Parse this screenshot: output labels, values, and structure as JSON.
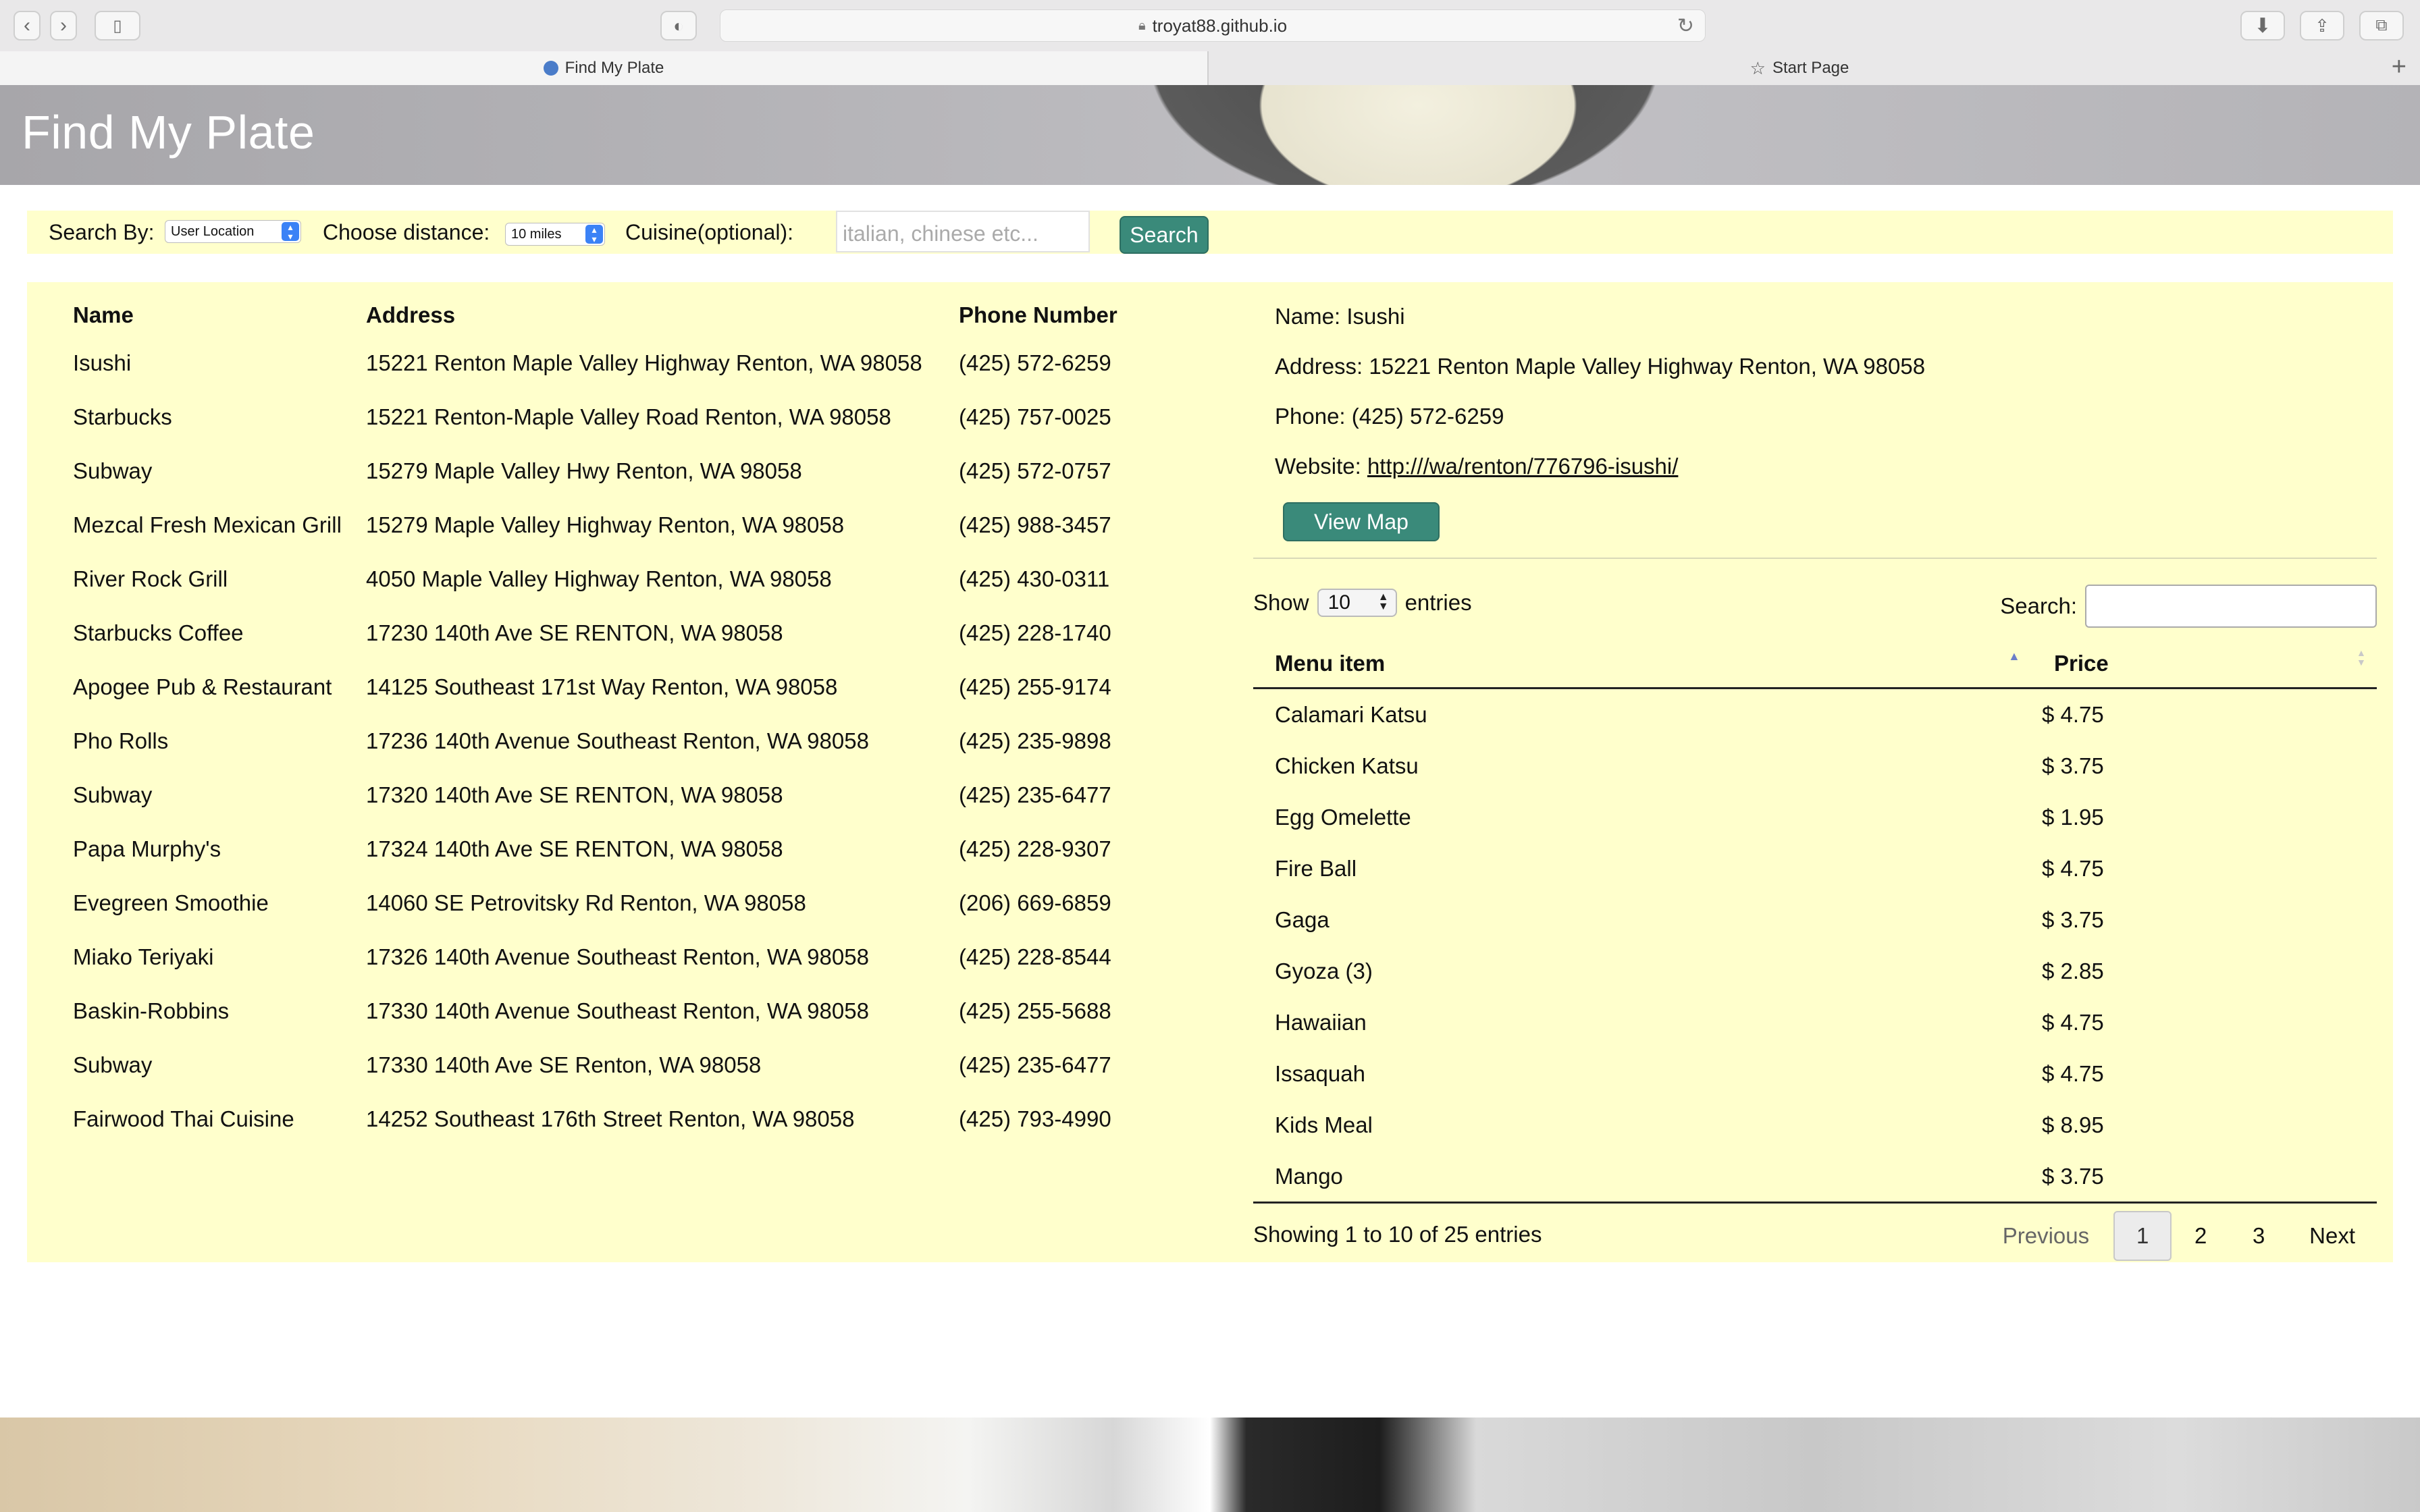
{
  "browser": {
    "url": "troyat88.github.io",
    "tabs": [
      {
        "label": "Find My Plate"
      },
      {
        "label": "Start Page"
      }
    ]
  },
  "header": {
    "title": "Find My Plate"
  },
  "search_bar": {
    "search_by_label": "Search By:",
    "search_by_value": "User Location",
    "distance_label": "Choose distance:",
    "distance_value": "10 miles",
    "cuisine_label": "Cuisine(optional):",
    "cuisine_placeholder": "italian, chinese etc...",
    "search_button": "Search"
  },
  "restaurants": {
    "columns": [
      "Name",
      "Address",
      "Phone Number"
    ],
    "rows": [
      {
        "name": "Isushi",
        "address": "15221 Renton Maple Valley Highway Renton, WA 98058",
        "phone": "(425) 572-6259"
      },
      {
        "name": "Starbucks",
        "address": "15221 Renton-Maple Valley Road Renton, WA 98058",
        "phone": "(425) 757-0025"
      },
      {
        "name": "Subway",
        "address": "15279 Maple Valley Hwy Renton, WA 98058",
        "phone": "(425) 572-0757"
      },
      {
        "name": "Mezcal Fresh Mexican Grill",
        "address": "15279 Maple Valley Highway Renton, WA 98058",
        "phone": "(425) 988-3457"
      },
      {
        "name": "River Rock Grill",
        "address": "4050 Maple Valley Highway Renton, WA 98058",
        "phone": "(425) 430-0311"
      },
      {
        "name": "Starbucks Coffee",
        "address": "17230 140th Ave SE RENTON, WA 98058",
        "phone": "(425) 228-1740"
      },
      {
        "name": "Apogee Pub & Restaurant",
        "address": "14125 Southeast 171st Way Renton, WA 98058",
        "phone": "(425) 255-9174"
      },
      {
        "name": "Pho Rolls",
        "address": "17236 140th Avenue Southeast Renton, WA 98058",
        "phone": "(425) 235-9898"
      },
      {
        "name": "Subway",
        "address": "17320 140th Ave SE RENTON, WA 98058",
        "phone": "(425) 235-6477"
      },
      {
        "name": "Papa Murphy's",
        "address": "17324 140th Ave SE RENTON, WA 98058",
        "phone": "(425) 228-9307"
      },
      {
        "name": "Evegreen Smoothie",
        "address": "14060 SE Petrovitsky Rd Renton, WA 98058",
        "phone": "(206) 669-6859"
      },
      {
        "name": "Miako Teriyaki",
        "address": "17326 140th Avenue Southeast Renton, WA 98058",
        "phone": "(425) 228-8544"
      },
      {
        "name": "Baskin-Robbins",
        "address": "17330 140th Avenue Southeast Renton, WA 98058",
        "phone": "(425) 255-5688"
      },
      {
        "name": "Subway",
        "address": "17330 140th Ave SE Renton, WA 98058",
        "phone": "(425) 235-6477"
      },
      {
        "name": "Fairwood Thai Cuisine",
        "address": "14252 Southeast 176th Street Renton, WA 98058",
        "phone": "(425) 793-4990"
      }
    ]
  },
  "detail": {
    "name": "Name: Isushi",
    "address": "Address: 15221 Renton Maple Valley Highway Renton, WA 98058",
    "phone": "Phone: (425) 572-6259",
    "website_label": "Website:",
    "website_url": "http:///wa/renton/776796-isushi/",
    "view_map_button": "View Map"
  },
  "menu": {
    "show_label": "Show",
    "entries_value": "10",
    "entries_label": "entries",
    "search_label": "Search:",
    "columns": [
      "Menu item",
      "Price"
    ],
    "rows": [
      {
        "item": "Calamari Katsu",
        "price": "$ 4.75"
      },
      {
        "item": "Chicken Katsu",
        "price": "$ 3.75"
      },
      {
        "item": "Egg Omelette",
        "price": "$ 1.95"
      },
      {
        "item": "Fire Ball",
        "price": "$ 4.75"
      },
      {
        "item": "Gaga",
        "price": "$ 3.75"
      },
      {
        "item": "Gyoza (3)",
        "price": "$ 2.85"
      },
      {
        "item": "Hawaiian",
        "price": "$ 4.75"
      },
      {
        "item": "Issaquah",
        "price": "$ 4.75"
      },
      {
        "item": "Kids Meal",
        "price": "$ 8.95"
      },
      {
        "item": "Mango",
        "price": "$ 3.75"
      }
    ],
    "info": "Showing 1 to 10 of 25 entries",
    "pagination": {
      "previous": "Previous",
      "pages": [
        "1",
        "2",
        "3"
      ],
      "next": "Next"
    }
  }
}
